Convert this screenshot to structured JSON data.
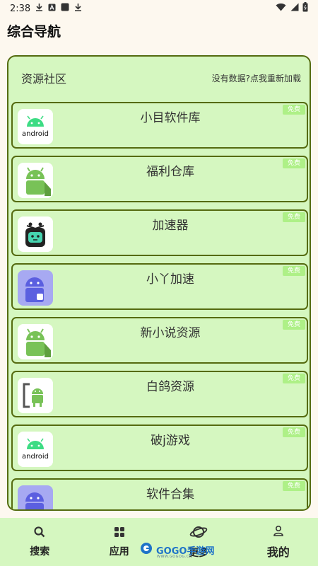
{
  "status_bar": {
    "time": "2:38"
  },
  "page": {
    "title": "综合导航"
  },
  "section": {
    "title": "资源社区",
    "reload_text": "没有数据?点我重新加载"
  },
  "apps": [
    {
      "name": "小目软件库",
      "badge": "免费",
      "icon": "android-logo-icon"
    },
    {
      "name": "福利仓库",
      "badge": "免费",
      "icon": "android-robot-icon"
    },
    {
      "name": "加速器",
      "badge": "免费",
      "icon": "robot-face-icon"
    },
    {
      "name": "小丫加速",
      "badge": "免费",
      "icon": "purple-android-icon"
    },
    {
      "name": "新小说资源",
      "badge": "免费",
      "icon": "android-robot-icon"
    },
    {
      "name": "白鸽资源",
      "badge": "免费",
      "icon": "android-frame-icon"
    },
    {
      "name": "破j游戏",
      "badge": "免费",
      "icon": "android-logo-icon"
    },
    {
      "name": "软件合集",
      "badge": "免费",
      "icon": "purple-android-icon"
    }
  ],
  "bottom_nav": [
    {
      "label": "搜索",
      "icon": "search-icon"
    },
    {
      "label": "应用",
      "icon": "apps-grid-icon"
    },
    {
      "label": "更多",
      "icon": "planet-icon"
    },
    {
      "label": "我的",
      "icon": "person-icon"
    }
  ],
  "watermark": {
    "text": "GOGO手游网",
    "sub": "WWW.GOGOG.CN"
  },
  "colors": {
    "card_bg": "#d5f7c0",
    "border": "#556b10",
    "badge_bg": "#aef087",
    "android_green": "#3ddc84",
    "page_bg": "#fdf8ef"
  }
}
